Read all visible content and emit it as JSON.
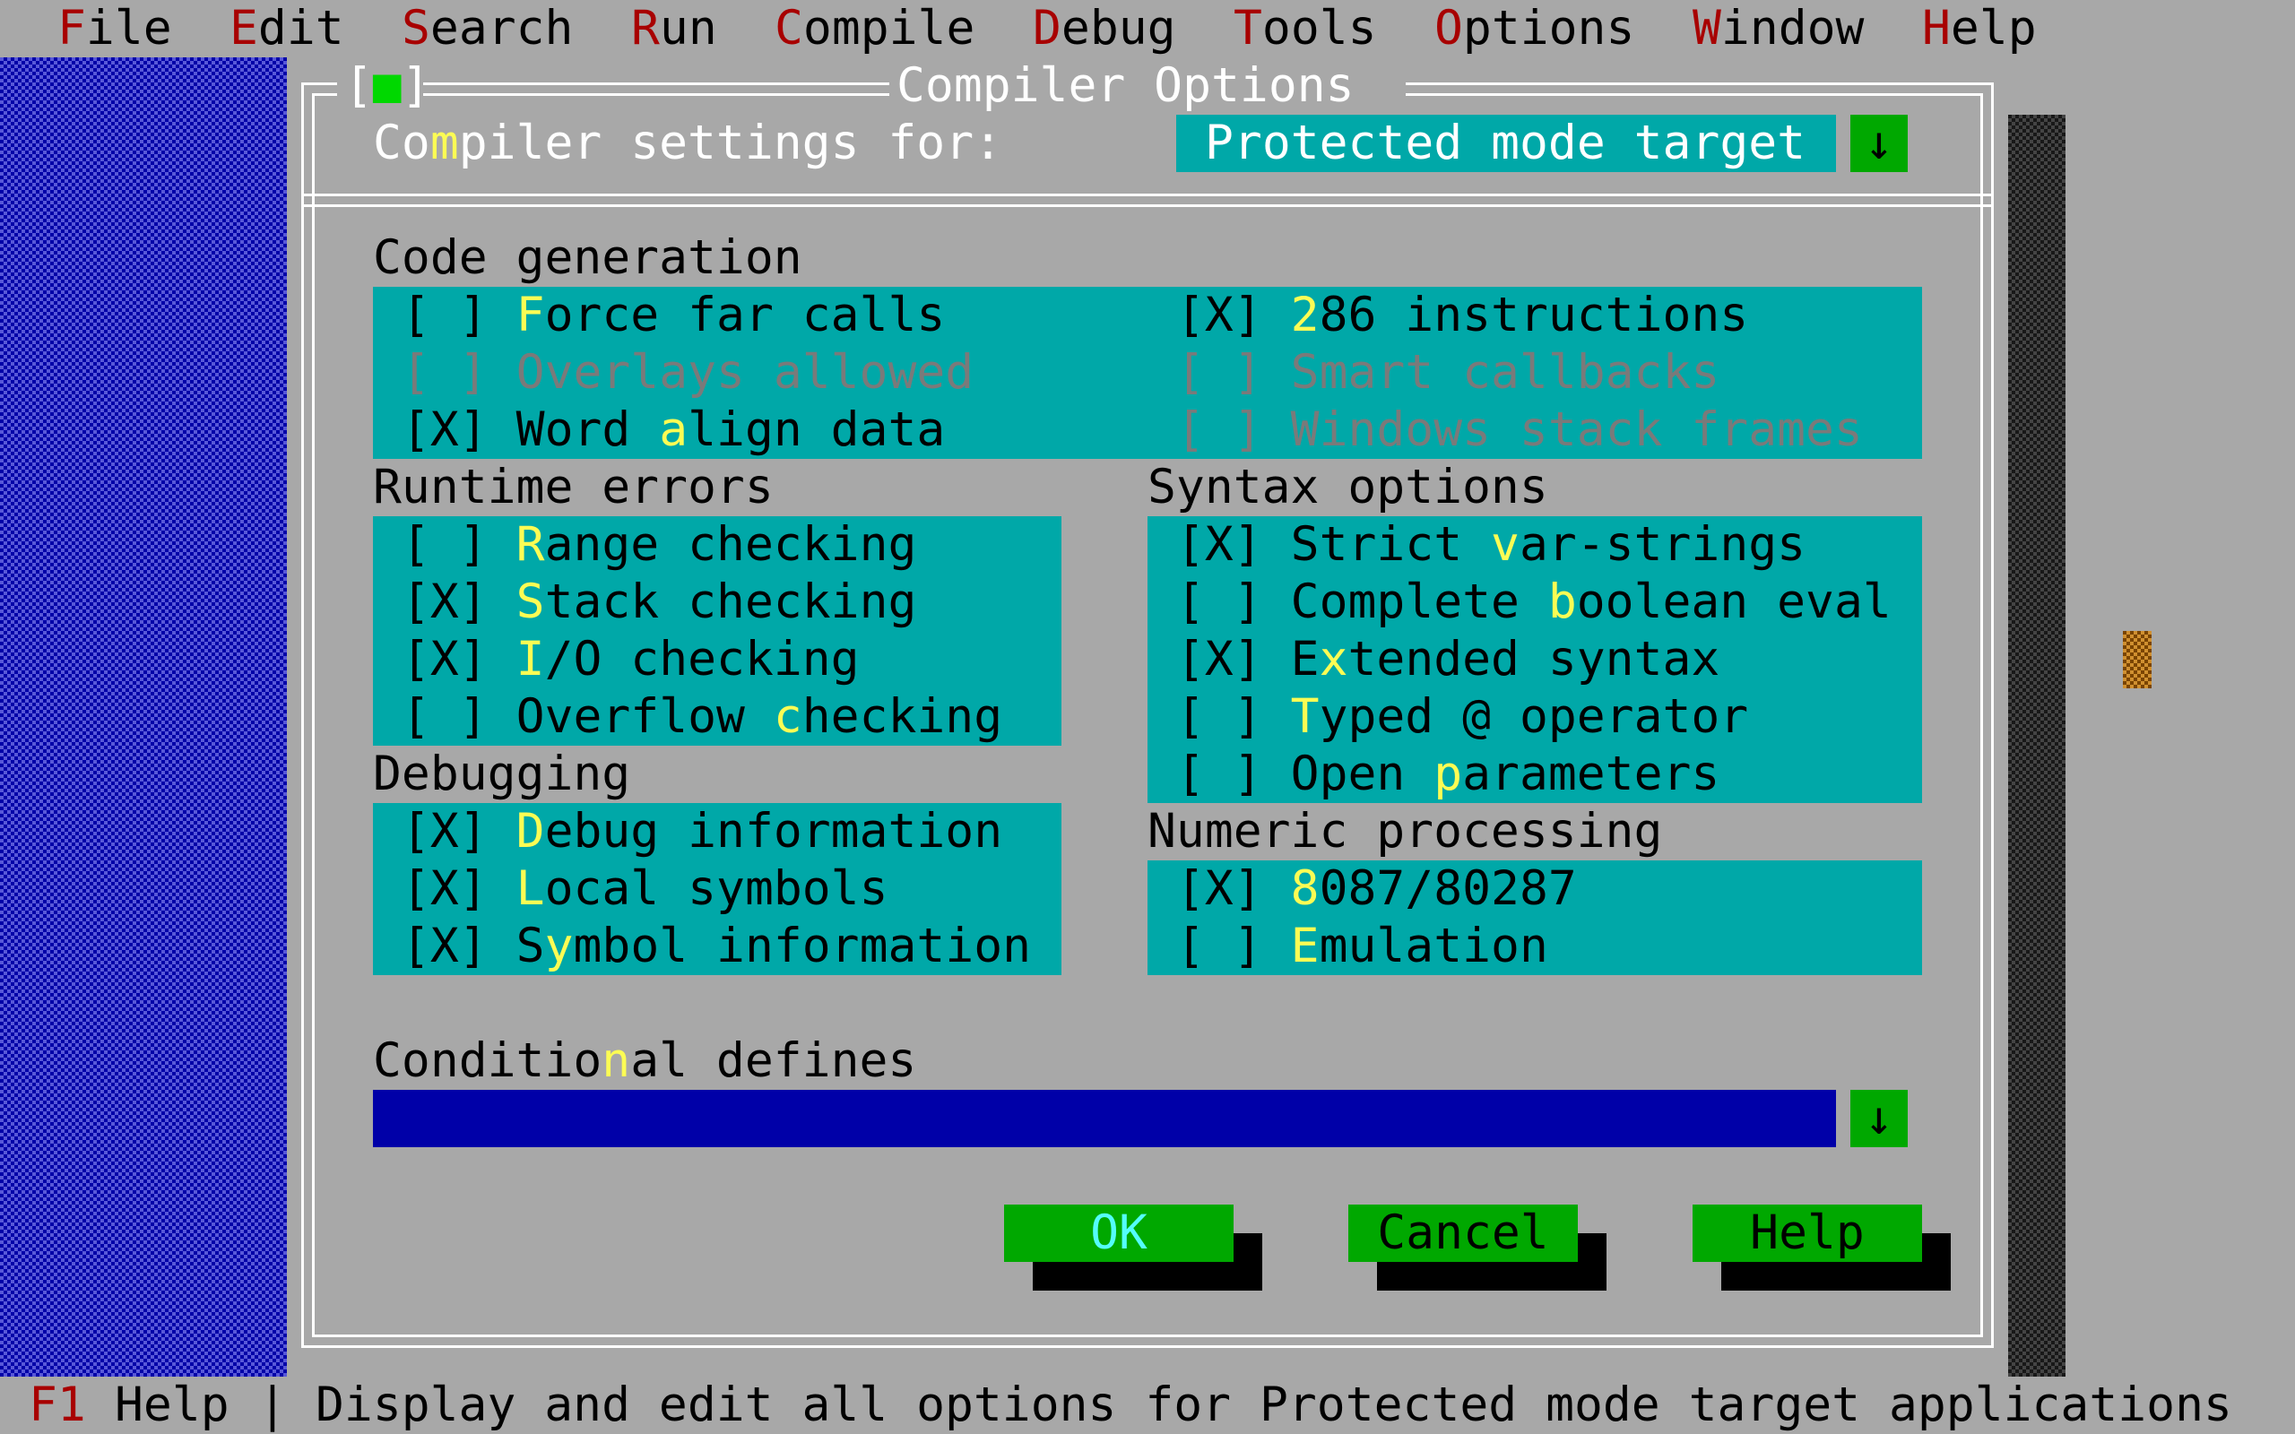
{
  "menu": [
    {
      "hot": "F",
      "rest": "ile"
    },
    {
      "hot": "E",
      "rest": "dit"
    },
    {
      "hot": "S",
      "rest": "earch"
    },
    {
      "hot": "R",
      "rest": "un"
    },
    {
      "hot": "C",
      "rest": "ompile"
    },
    {
      "hot": "D",
      "rest": "ebug"
    },
    {
      "hot": "T",
      "rest": "ools"
    },
    {
      "hot": "O",
      "rest": "ptions"
    },
    {
      "hot": "W",
      "rest": "indow"
    },
    {
      "hot": "H",
      "rest": "elp"
    }
  ],
  "dialog": {
    "title": "Compiler Options",
    "close_open": "[",
    "close_glyph": "■",
    "close_close": "]",
    "settings_label_pre": "Co",
    "settings_label_hot": "m",
    "settings_label_post": "piler settings for:",
    "target_value": "Protected mode target",
    "arrow": "↓",
    "code_generation": {
      "title": "Code generation",
      "left": [
        {
          "box": "[ ]",
          "pre": "",
          "hot": "F",
          "post": "orce far calls",
          "disabled": false
        },
        {
          "box": "[ ]",
          "pre": "",
          "hot": "",
          "post": "Overlays allowed",
          "disabled": true
        },
        {
          "box": "[X]",
          "pre": "Word ",
          "hot": "a",
          "post": "lign data",
          "disabled": false
        }
      ],
      "right": [
        {
          "box": "[X]",
          "pre": "",
          "hot": "2",
          "post": "86 instructions",
          "disabled": false
        },
        {
          "box": "[ ]",
          "pre": "",
          "hot": "",
          "post": "Smart callbacks",
          "disabled": true
        },
        {
          "box": "[ ]",
          "pre": "",
          "hot": "",
          "post": "Windows stack frames",
          "disabled": true
        }
      ]
    },
    "runtime_errors": {
      "title": "Runtime errors",
      "items": [
        {
          "box": "[ ]",
          "pre": "",
          "hot": "R",
          "post": "ange checking"
        },
        {
          "box": "[X]",
          "pre": "",
          "hot": "S",
          "post": "tack checking"
        },
        {
          "box": "[X]",
          "pre": "",
          "hot": "I",
          "post": "/O checking"
        },
        {
          "box": "[ ]",
          "pre": "Overflow ",
          "hot": "c",
          "post": "hecking"
        }
      ]
    },
    "syntax_options": {
      "title": "Syntax options",
      "items": [
        {
          "box": "[X]",
          "pre": "Strict ",
          "hot": "v",
          "post": "ar-strings"
        },
        {
          "box": "[ ]",
          "pre": "Complete ",
          "hot": "b",
          "post": "oolean eval"
        },
        {
          "box": "[X]",
          "pre": "E",
          "hot": "x",
          "post": "tended syntax"
        },
        {
          "box": "[ ]",
          "pre": "",
          "hot": "T",
          "post": "yped @ operator"
        },
        {
          "box": "[ ]",
          "pre": "Open ",
          "hot": "p",
          "post": "arameters"
        }
      ]
    },
    "debugging": {
      "title": "Debugging",
      "items": [
        {
          "box": "[X]",
          "pre": "",
          "hot": "D",
          "post": "ebug information"
        },
        {
          "box": "[X]",
          "pre": "",
          "hot": "L",
          "post": "ocal symbols"
        },
        {
          "box": "[X]",
          "pre": "S",
          "hot": "y",
          "post": "mbol information"
        }
      ]
    },
    "numeric_processing": {
      "title": "Numeric processing",
      "items": [
        {
          "box": "[X]",
          "pre": "",
          "hot": "8",
          "post": "087/80287"
        },
        {
          "box": "[ ]",
          "pre": "",
          "hot": "E",
          "post": "mulation"
        }
      ]
    },
    "defines_label_pre": "Conditio",
    "defines_label_hot": "n",
    "defines_label_post": "al defines",
    "defines_value": "",
    "buttons": {
      "ok": "OK",
      "cancel": "Cancel",
      "help": "Help"
    }
  },
  "status": {
    "key": "F1",
    "key_label": "Help",
    "separator": "|",
    "message": "Display and edit all options for Protected mode target applications"
  },
  "colors": {
    "menu_hotkey": "#a80000",
    "dialog_bg": "#a8a8a8",
    "cluster_bg": "#00a8a8",
    "hotkey": "#fcfc54",
    "button_bg": "#00a800",
    "input_bg": "#0000a8"
  }
}
